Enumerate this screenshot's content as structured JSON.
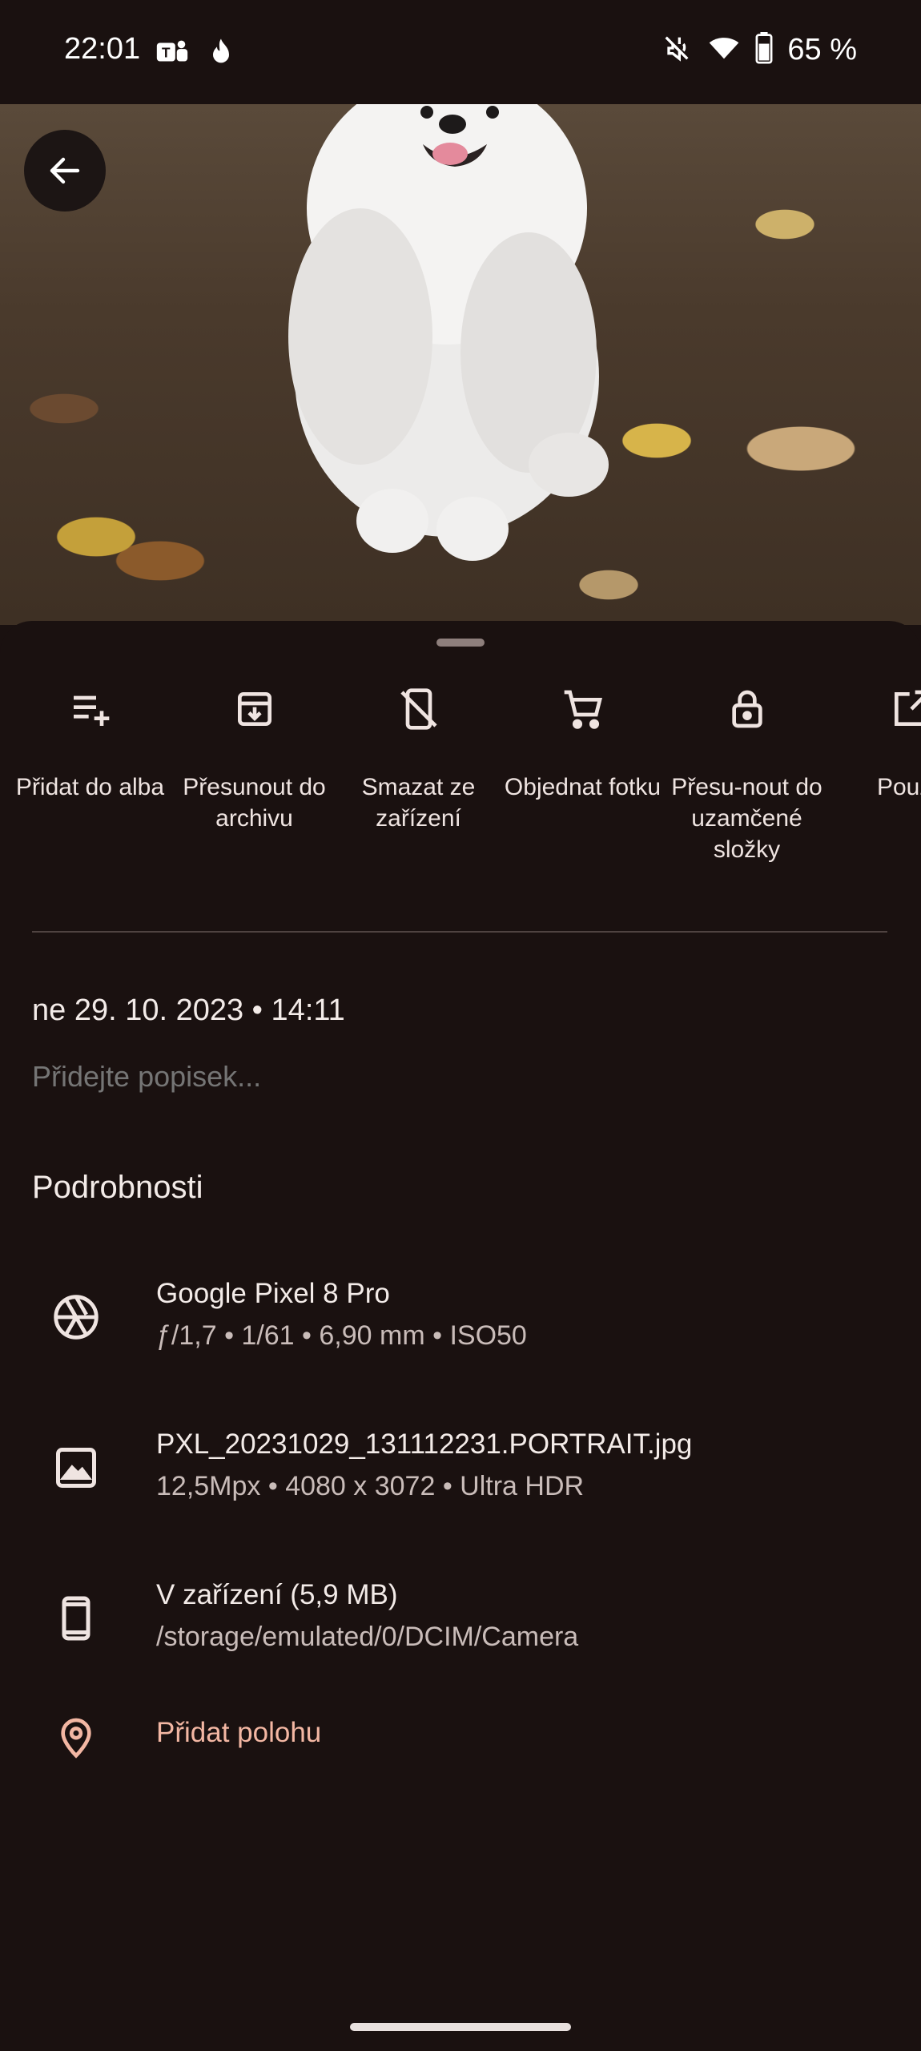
{
  "status_bar": {
    "time": "22:01",
    "battery": "65 %",
    "icons": [
      "teams-icon",
      "fire-icon",
      "mute-icon",
      "wifi-icon",
      "battery-icon"
    ]
  },
  "actions": [
    {
      "label": "Přidat do alba",
      "icon": "playlist-add-icon"
    },
    {
      "label": "Přesunout do archivu",
      "icon": "archive-icon"
    },
    {
      "label": "Smazat ze zařízení",
      "icon": "device-off-icon"
    },
    {
      "label": "Objednat fotku",
      "icon": "cart-icon"
    },
    {
      "label": "Přesu-nout do uzamčené složky",
      "icon": "lock-icon"
    },
    {
      "label": "Použít",
      "icon": "open-in-icon"
    }
  ],
  "date_line": "ne 29. 10. 2023  •  14:11",
  "caption_placeholder": "Přidejte popisek...",
  "details_title": "Podrobnosti",
  "details": {
    "camera": {
      "title": "Google Pixel 8 Pro",
      "sub": "ƒ/1,7  •  1/61  •  6,90 mm  •  ISO50"
    },
    "file": {
      "title": "PXL_20231029_131112231.PORTRAIT.jpg",
      "sub": "12,5Mpx  •  4080 x 3072  •  Ultra HDR"
    },
    "storage": {
      "title": "V zařízení (5,9 MB)",
      "sub": "/storage/emulated/0/DCIM/Camera"
    },
    "location": {
      "label": "Přidat polohu"
    }
  },
  "colors": {
    "background": "#1a1110",
    "accent": "#f3b7a3"
  }
}
